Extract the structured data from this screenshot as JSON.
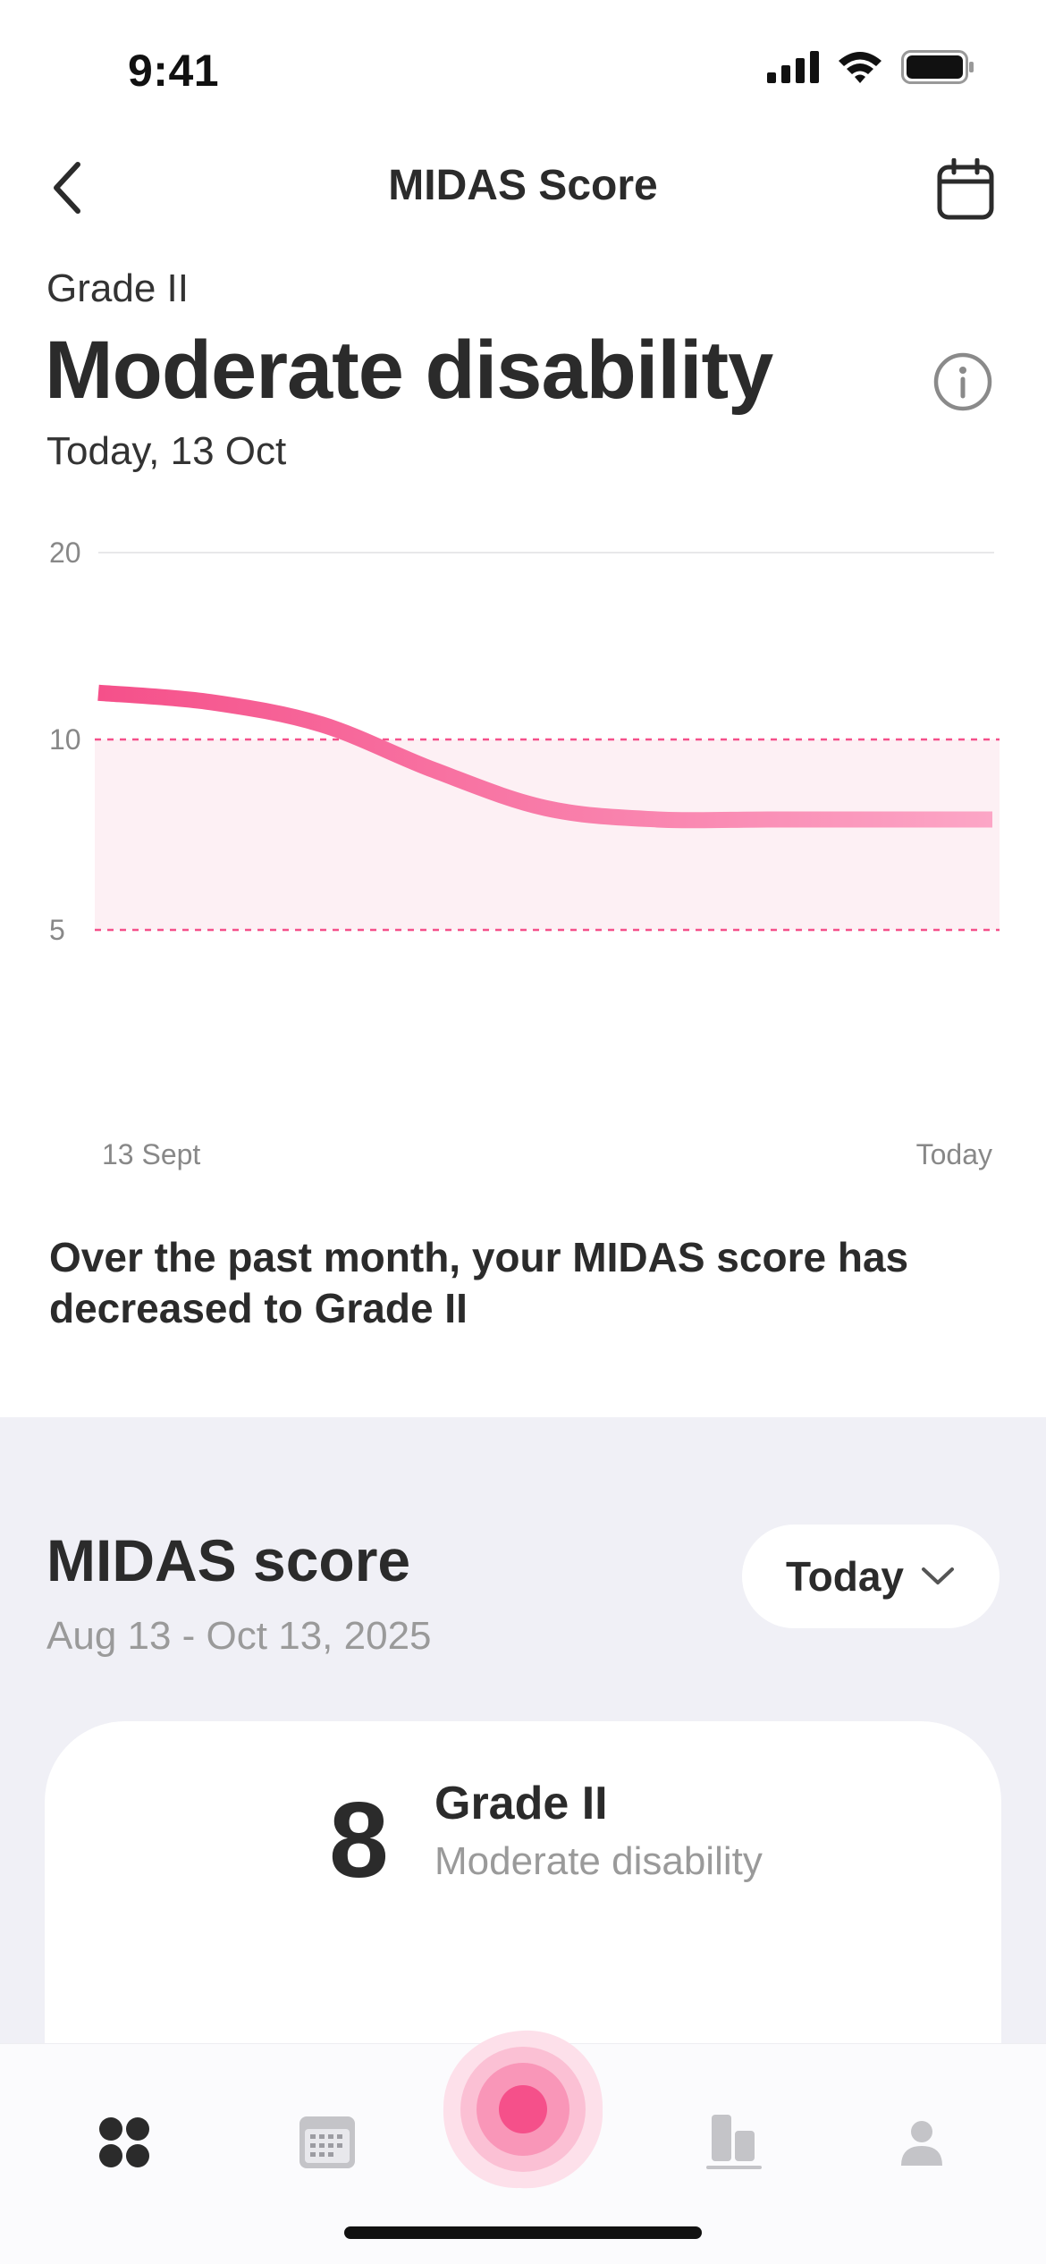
{
  "status_bar": {
    "time": "9:41"
  },
  "nav": {
    "title": "MIDAS Score"
  },
  "header": {
    "grade": "Grade II",
    "headline": "Moderate disability",
    "date": "Today, 13 Oct"
  },
  "chart_data": {
    "type": "line",
    "title": "",
    "y_ticks": [
      "20",
      "10",
      "5"
    ],
    "x_labels": {
      "start": "13 Sept",
      "end": "Today"
    },
    "ylim": [
      5,
      20
    ],
    "series": [
      {
        "values": [
          12.5,
          12.0,
          10.8,
          9.2,
          8.2,
          7.9,
          7.9,
          7.9,
          7.9
        ]
      }
    ],
    "band": {
      "from": 5,
      "to": 10
    },
    "grid": true,
    "colors": {
      "line_start": "#f5508a",
      "line_end": "#fca6c6",
      "band": "#fdf0f4",
      "band_line": "#f5508a"
    }
  },
  "summary": "Over the past month, your MIDAS score has decreased to Grade II",
  "section": {
    "title": "MIDAS score",
    "range": "Aug 13 - Oct 13, 2025",
    "period_button": "Today"
  },
  "score_card": {
    "score": "8",
    "grade": "Grade II",
    "description": "Moderate disability"
  },
  "tab_bar": {
    "tabs": [
      "dashboard-icon",
      "calendar-icon",
      "record-icon",
      "stats-icon",
      "profile-icon"
    ]
  },
  "colors": {
    "accent": "#f5508a",
    "accent_light": "#fca0c2",
    "background_lower": "#f0f0f6"
  }
}
